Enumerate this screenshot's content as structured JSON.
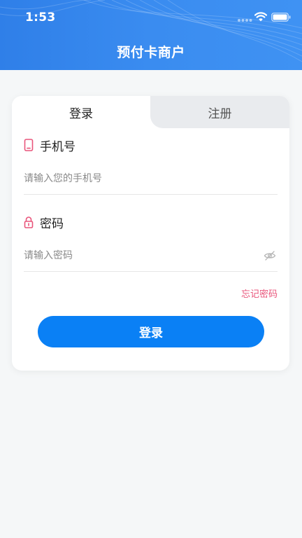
{
  "status_bar": {
    "time": "1:53"
  },
  "header": {
    "title": "预付卡商户"
  },
  "tabs": [
    {
      "label": "登录",
      "active": true
    },
    {
      "label": "注册",
      "active": false
    }
  ],
  "phone_field": {
    "label": "手机号",
    "placeholder": "请输入您的手机号",
    "value": "",
    "icon": "phone-icon"
  },
  "password_field": {
    "label": "密码",
    "placeholder": "请输入密码",
    "value": "",
    "icon": "lock-icon",
    "toggle_icon": "eye-hidden-icon"
  },
  "forgot_password": "忘记密码",
  "login_button": "登录",
  "colors": {
    "header_blue": "#3a8cf0",
    "accent_pink": "#e9557b",
    "button_blue": "#0a80f5",
    "background": "#f5f7f8"
  }
}
